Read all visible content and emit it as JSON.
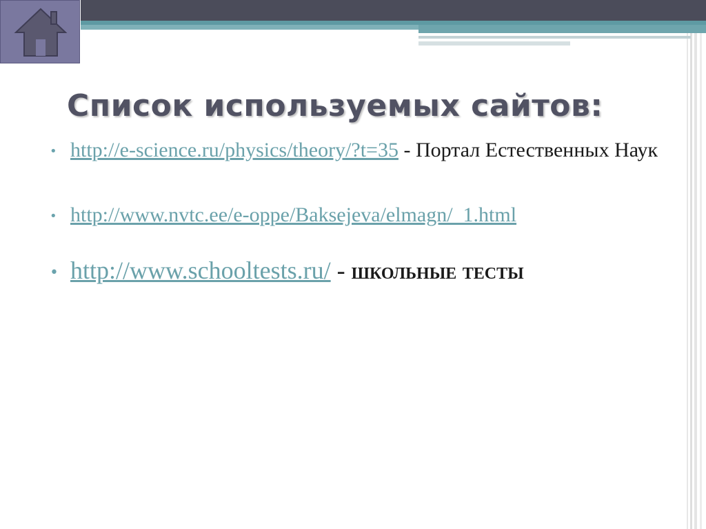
{
  "slide": {
    "title": "Список используемых сайтов:",
    "home_icon": "home-icon",
    "colors": {
      "topbar": "#4b4c5a",
      "teal": "#5e9aa3",
      "home_button": "#7a789f",
      "link": "#6aa1aa",
      "title": "#515263"
    },
    "bullets": [
      {
        "link": "http://e-science.ru/physics/theory/?t=35",
        "separator": " - ",
        "description": "Портал Естественных Наук"
      },
      {
        "link": "http://www.nvtc.ee/e-oppe/Baksejeva/elmagn/_1.html"
      },
      {
        "link": "http://www.schooltests.ru/",
        "separator": " - ",
        "description": "школьные тесты"
      }
    ]
  }
}
